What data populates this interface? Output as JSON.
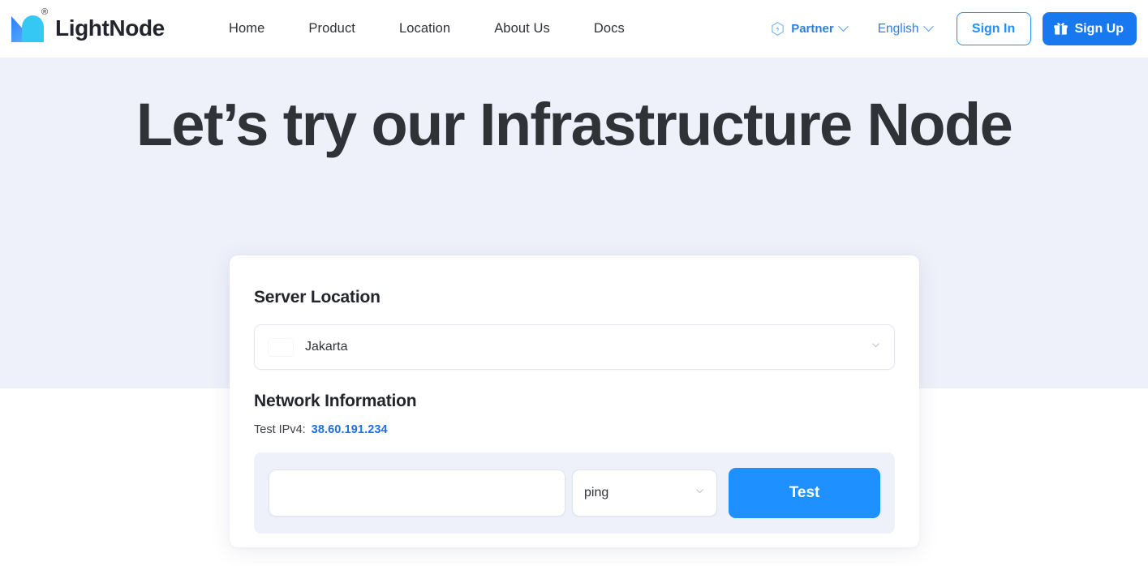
{
  "brand": {
    "name": "LightNode",
    "registered_mark": "®",
    "logo_icon": "lightnode-logo-icon"
  },
  "nav": {
    "links": [
      {
        "label": "Home"
      },
      {
        "label": "Product"
      },
      {
        "label": "Location"
      },
      {
        "label": "About Us"
      },
      {
        "label": "Docs"
      }
    ],
    "partner": {
      "label": "Partner",
      "icon": "hexagon-partner-icon",
      "caret": "chevron-down-icon"
    },
    "language": {
      "label": "English",
      "caret": "chevron-down-icon"
    },
    "sign_in": "Sign In",
    "sign_up": "Sign Up",
    "sign_up_icon": "gift-icon"
  },
  "hero": {
    "title": "Let’s try our Infrastructure Node"
  },
  "card": {
    "server_location_heading": "Server Location",
    "location": {
      "value": "Jakarta",
      "flag": "indonesia-flag-icon",
      "caret": "chevron-down-icon"
    },
    "network_heading": "Network Information",
    "ip_label": "Test IPv4:",
    "ip_value": "38.60.191.234",
    "host_input": {
      "value": "",
      "placeholder": ""
    },
    "protocol": {
      "value": "ping",
      "caret": "chevron-down-icon"
    },
    "test_button": "Test"
  },
  "colors": {
    "accent_blue": "#1e90ff",
    "signup_blue": "#1878f0",
    "link_blue": "#2f7fe0",
    "ip_blue": "#1e6fe0",
    "hero_bg": "#eef1fa",
    "panel_bg": "#eef1fa",
    "flag_red": "#e8192c",
    "text_dark": "#2f3237"
  }
}
